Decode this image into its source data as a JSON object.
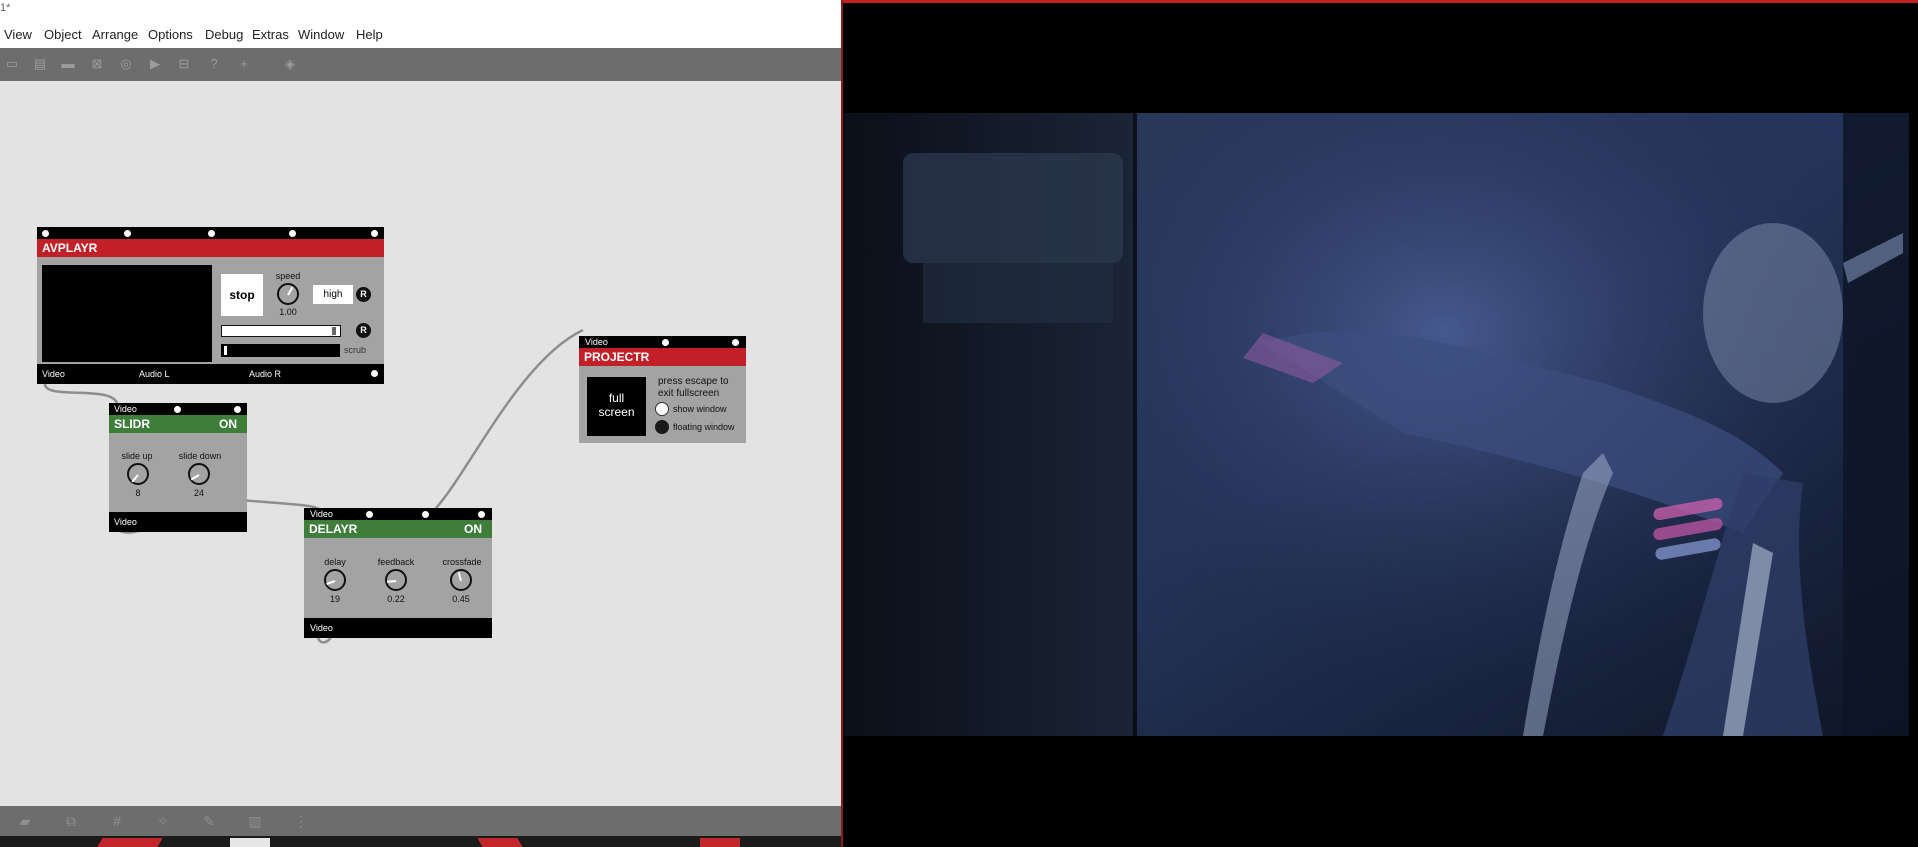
{
  "window": {
    "title_fragment": "1*"
  },
  "menu": [
    "View",
    "Object",
    "Arrange",
    "Options",
    "Debug",
    "Extras",
    "Window",
    "Help"
  ],
  "toolbar_icons": [
    "presentation-icon",
    "new-object-icon",
    "comment-icon",
    "message-icon",
    "toggle-icon",
    "bang-icon",
    "slider-icon",
    "number-icon",
    "help-icon",
    "add-icon",
    "paint-icon"
  ],
  "bottombar_icons": [
    "comment-icon",
    "layers-icon",
    "grid-icon",
    "snap-icon",
    "wrench-icon",
    "bpatcher-icon",
    "grid-dots-icon"
  ],
  "modules": {
    "avplayr": {
      "title": "AVPLAYR",
      "stop_label": "stop",
      "speed_label": "speed",
      "speed_value": "1.00",
      "quality_label": "high",
      "r_label": "R",
      "scrub_label": "scrub",
      "out_video": "Video",
      "out_audio_l": "Audio L",
      "out_audio_r": "Audio R"
    },
    "slidr": {
      "input_label": "Video",
      "title": "SLIDR",
      "state": "ON",
      "slide_up_label": "slide up",
      "slide_up_value": "8",
      "slide_down_label": "slide down",
      "slide_down_value": "24",
      "output_label": "Video"
    },
    "delayr": {
      "input_label": "Video",
      "title": "DELAYR",
      "state": "ON",
      "delay_label": "delay",
      "delay_value": "19",
      "feedback_label": "feedback",
      "feedback_value": "0.22",
      "crossfade_label": "crossfade",
      "crossfade_value": "0.45",
      "output_label": "Video"
    },
    "projectr": {
      "input_label": "Video",
      "title": "PROJECTR",
      "fullscreen_label_1": "full",
      "fullscreen_label_2": "screen",
      "hint_line_1": "press escape to",
      "hint_line_2": "exit fullscreen",
      "show_window_label": "show window",
      "floating_window_label": "floating window"
    }
  },
  "colors": {
    "avplayr_header": "#c22028",
    "projectr_header": "#c22028",
    "effect_header": "#3e7d3a",
    "module_body": "#a3a3a3",
    "canvas": "#e3e3e3",
    "toolbar": "#6d6d6d",
    "video_window_border": "#c21f22"
  }
}
